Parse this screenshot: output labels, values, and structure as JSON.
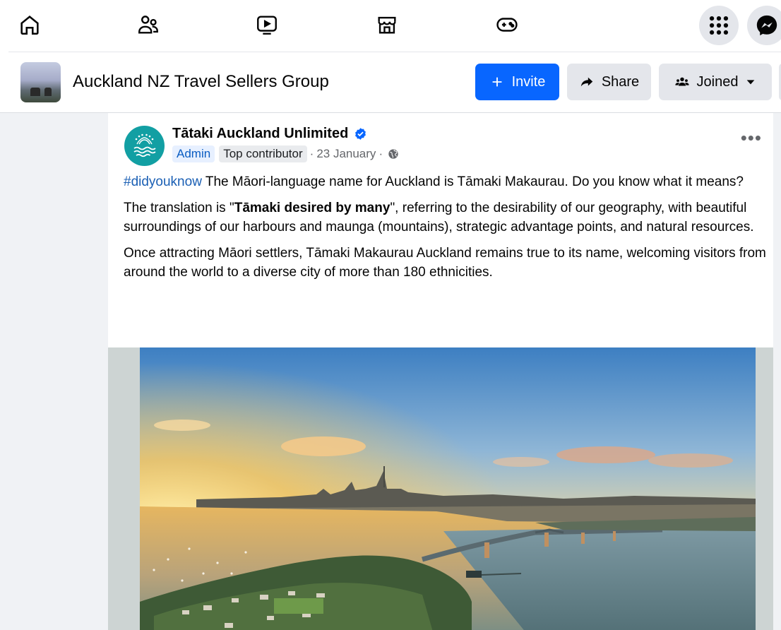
{
  "nav": {
    "icons": [
      "home-icon",
      "friends-icon",
      "watch-icon",
      "marketplace-icon",
      "gaming-icon",
      "menu-grid-icon",
      "messenger-icon"
    ]
  },
  "group": {
    "title": "Auckland NZ Travel Sellers Group",
    "invite_label": "Invite",
    "share_label": "Share",
    "joined_label": "Joined"
  },
  "post": {
    "author": "Tātaki Auckland Unlimited",
    "badge_admin": "Admin",
    "badge_top": "Top contributor",
    "date": "23 January",
    "separator": "·",
    "more_label": "•••",
    "p1_hashtag": "#didyouknow",
    "p1_text": " The Māori-language name for Auckland is Tāmaki Makaurau. Do you know what it means?",
    "p2_prefix": "The translation is \"",
    "p2_bold": "Tāmaki desired by many",
    "p2_suffix": "\", referring to the desirability of our geography, with beautiful surroundings of our harbours and maunga (mountains), strategic advantage points, and natural resources.",
    "p3_text": "Once attracting Māori settlers, Tāmaki Makaurau Auckland remains true to its name, welcoming visitors from around the world to a diverse city of more than 180 ethnicities."
  },
  "colors": {
    "accent": "#0866ff",
    "hashtag": "#1a5fb4",
    "avatar_bg": "#129fa3"
  }
}
